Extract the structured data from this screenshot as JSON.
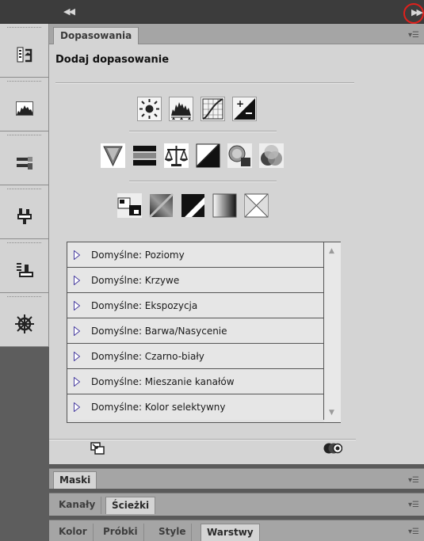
{
  "panel": {
    "tab": "Dopasowania",
    "title": "Dodaj dopasowanie"
  },
  "presets": [
    "Domyślne: Poziomy",
    "Domyślne: Krzywe",
    "Domyślne: Ekspozycja",
    "Domyślne: Barwa/Nasycenie",
    "Domyślne: Czarno-biały",
    "Domyślne: Mieszanie kanałów",
    "Domyślne: Kolor selektywny"
  ],
  "collapsed_panels": {
    "maski": [
      "Maski"
    ],
    "kanaly": [
      "Kanały",
      "Ścieżki"
    ],
    "kolor": [
      "Kolor",
      "Próbki",
      "Style",
      "Warstwy"
    ]
  },
  "colors": {
    "highlight_ring": "#e0201c",
    "triangle": "#4a3fa0"
  },
  "icons": {
    "dock": [
      "history-icon",
      "histogram-icon",
      "brushes-icon",
      "actions-icon",
      "clone-source-icon",
      "navigator-icon"
    ],
    "row1": [
      "brightness-contrast-icon",
      "levels-icon",
      "curves-icon",
      "exposure-icon"
    ],
    "row2": [
      "vibrance-icon",
      "hue-saturation-icon",
      "color-balance-icon",
      "black-white-icon",
      "photo-filter-icon",
      "channel-mixer-icon"
    ],
    "row3": [
      "invert-icon",
      "posterize-icon",
      "threshold-icon",
      "gradient-map-icon",
      "selective-color-icon"
    ]
  }
}
